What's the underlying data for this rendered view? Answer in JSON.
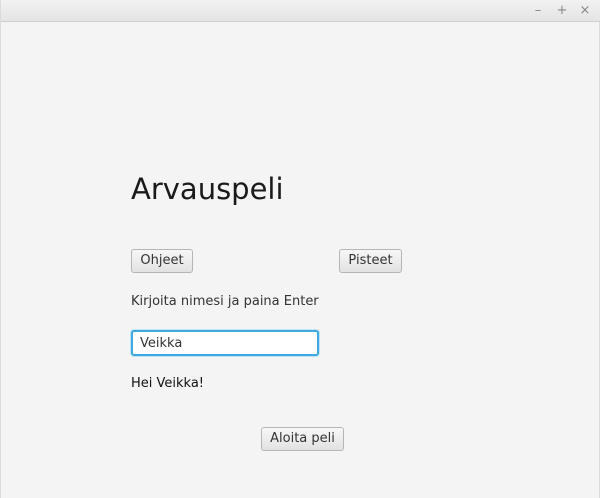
{
  "window": {
    "controls": {
      "minimize": "–",
      "maximize": "+",
      "close": "×"
    }
  },
  "main": {
    "title": "Arvauspeli",
    "instructions_button": "Ohjeet",
    "scores_button": "Pisteet",
    "prompt": "Kirjoita nimesi ja paina Enter",
    "name_input_value": "Veikka",
    "greeting": "Hei Veikka!",
    "start_button": "Aloita peli"
  },
  "colors": {
    "background": "#f4f4f4",
    "focus_ring": "#3fa9e0"
  }
}
